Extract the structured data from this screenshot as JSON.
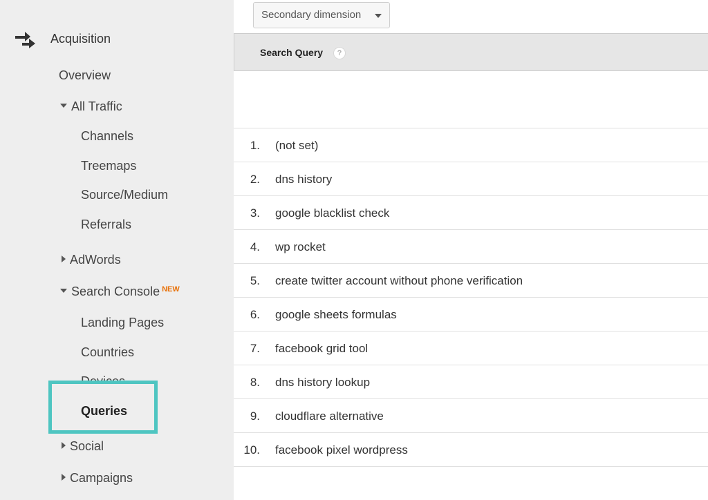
{
  "sidebar": {
    "section_title": "Acquisition",
    "overview": "Overview",
    "all_traffic": {
      "label": "All Traffic",
      "items": [
        "Channels",
        "Treemaps",
        "Source/Medium",
        "Referrals"
      ]
    },
    "adwords": "AdWords",
    "search_console": {
      "label": "Search Console",
      "badge": "NEW",
      "items": [
        "Landing Pages",
        "Countries",
        "Devices",
        "Queries"
      ]
    },
    "social": "Social",
    "campaigns": "Campaigns",
    "highlight_color": "#4ec5c1"
  },
  "toolbar": {
    "secondary_dimension": "Secondary dimension"
  },
  "table": {
    "header": "Search Query",
    "help": "?",
    "rows": [
      {
        "num": "1.",
        "query": "(not set)"
      },
      {
        "num": "2.",
        "query": "dns history"
      },
      {
        "num": "3.",
        "query": "google blacklist check"
      },
      {
        "num": "4.",
        "query": "wp rocket"
      },
      {
        "num": "5.",
        "query": "create twitter account without phone verification"
      },
      {
        "num": "6.",
        "query": "google sheets formulas"
      },
      {
        "num": "7.",
        "query": "facebook grid tool"
      },
      {
        "num": "8.",
        "query": "dns history lookup"
      },
      {
        "num": "9.",
        "query": "cloudflare alternative"
      },
      {
        "num": "10.",
        "query": "facebook pixel wordpress"
      }
    ]
  }
}
